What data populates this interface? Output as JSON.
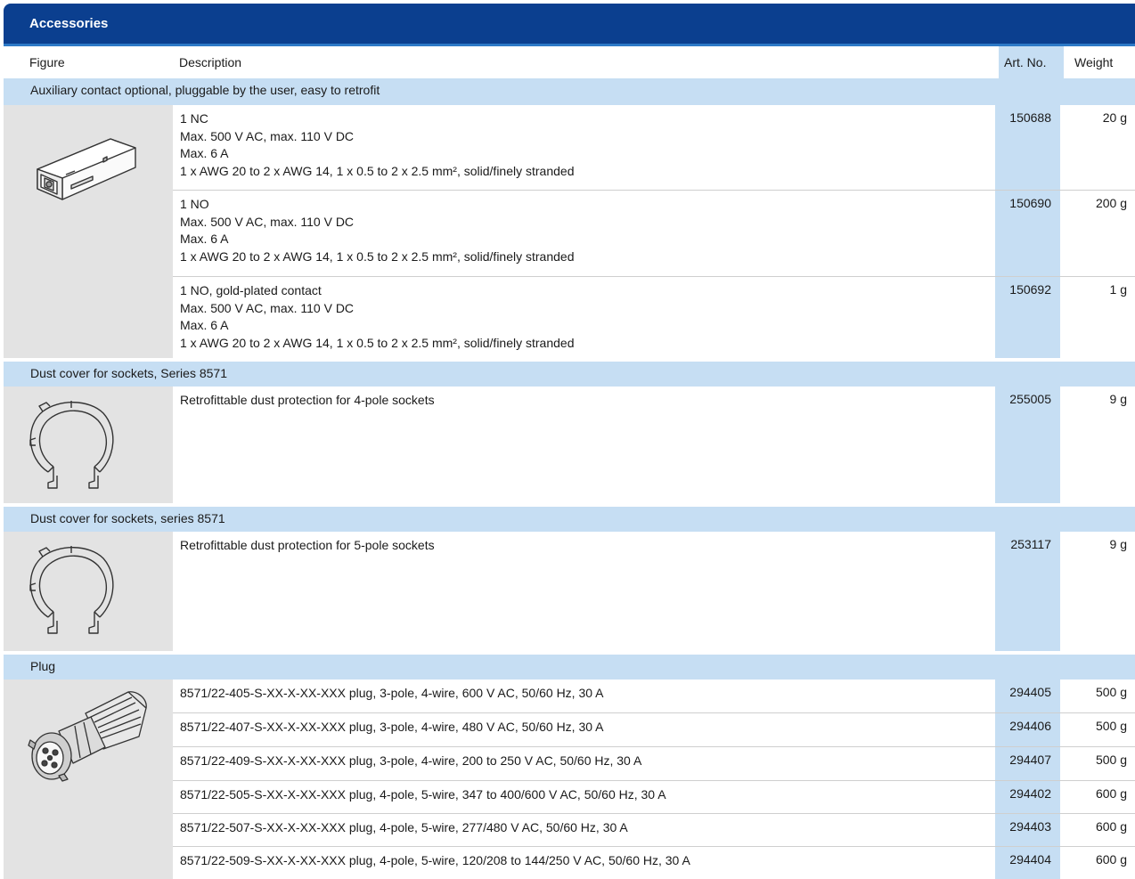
{
  "title": "Accessories",
  "header": {
    "figure": "Figure",
    "description": "Description",
    "art_no": "Art. No.",
    "weight": "Weight"
  },
  "groups": [
    {
      "category": "Auxiliary contact optional, pluggable by the user, easy to retrofit",
      "figure_icon": "auxiliary-contact-icon",
      "rows": [
        {
          "lines": [
            "1 NC",
            "Max. 500 V AC, max. 110 V DC",
            "Max. 6 A",
            "1 x AWG 20 to 2 x AWG 14, 1 x 0.5 to 2 x 2.5 mm², solid/finely stranded"
          ],
          "art": "150688",
          "weight": "20 g"
        },
        {
          "lines": [
            "1 NO",
            "Max. 500 V AC, max. 110 V DC",
            "Max. 6 A",
            "1 x AWG 20 to 2 x AWG 14, 1 x 0.5 to 2 x 2.5 mm², solid/finely stranded"
          ],
          "art": "150690",
          "weight": "200 g"
        },
        {
          "lines": [
            "1 NO, gold-plated contact",
            "Max. 500 V AC, max. 110 V DC",
            "Max. 6 A",
            "1 x AWG 20 to 2 x AWG 14, 1 x 0.5 to 2 x 2.5 mm², solid/finely stranded"
          ],
          "art": "150692",
          "weight": "1 g"
        }
      ]
    },
    {
      "category": "Dust cover for sockets, Series 8571",
      "figure_icon": "dust-cover-ring-icon",
      "rows": [
        {
          "lines": [
            "Retrofittable dust protection for 4-pole sockets"
          ],
          "art": "255005",
          "weight": "9 g"
        }
      ]
    },
    {
      "category": "Dust cover for sockets, series 8571",
      "figure_icon": "dust-cover-ring-icon",
      "rows": [
        {
          "lines": [
            "Retrofittable dust protection for 5-pole sockets"
          ],
          "art": "253117",
          "weight": "9 g"
        }
      ]
    },
    {
      "category": "Plug",
      "figure_icon": "plug-icon",
      "rows": [
        {
          "lines": [
            "8571/22-405-S-XX-X-XX-XXX plug, 3-pole, 4-wire, 600 V AC, 50/60 Hz, 30 A"
          ],
          "art": "294405",
          "weight": "500 g"
        },
        {
          "lines": [
            "8571/22-407-S-XX-X-XX-XXX plug, 3-pole, 4-wire, 480 V AC, 50/60 Hz, 30 A"
          ],
          "art": "294406",
          "weight": "500 g"
        },
        {
          "lines": [
            "8571/22-409-S-XX-X-XX-XXX plug, 3-pole, 4-wire, 200 to 250 V AC, 50/60 Hz, 30 A"
          ],
          "art": "294407",
          "weight": "500 g"
        },
        {
          "lines": [
            "8571/22-505-S-XX-X-XX-XXX plug, 4-pole, 5-wire, 347 to 400/600 V AC, 50/60 Hz, 30 A"
          ],
          "art": "294402",
          "weight": "600 g"
        },
        {
          "lines": [
            "8571/22-507-S-XX-X-XX-XXX plug, 4-pole, 5-wire, 277/480 V AC, 50/60 Hz, 30 A"
          ],
          "art": "294403",
          "weight": "600 g"
        },
        {
          "lines": [
            "8571/22-509-S-XX-X-XX-XXX plug, 4-pole, 5-wire, 120/208 to 144/250 V AC, 50/60 Hz, 30 A"
          ],
          "art": "294404",
          "weight": "600 g"
        }
      ]
    }
  ]
}
